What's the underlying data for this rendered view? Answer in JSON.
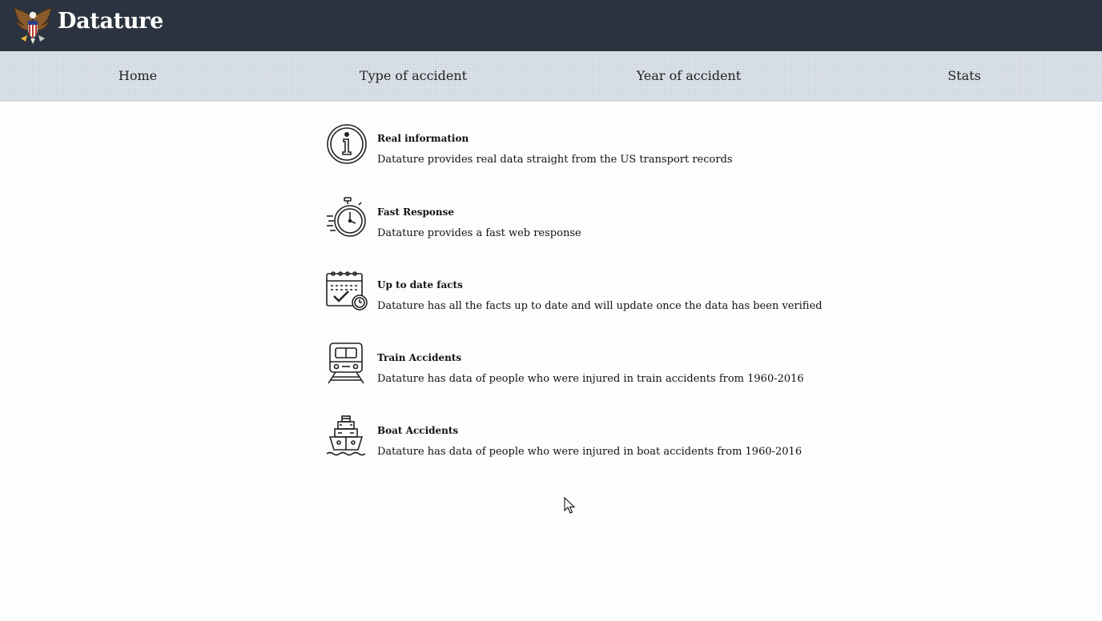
{
  "header": {
    "brand": "Datature",
    "logo_icon": "eagle-emblem-icon"
  },
  "nav": {
    "items": [
      {
        "label": "Home"
      },
      {
        "label": "Type of accident"
      },
      {
        "label": "Year of accident"
      },
      {
        "label": "Stats"
      }
    ]
  },
  "features": [
    {
      "icon": "info-icon",
      "title": "Real information",
      "description": "Datature provides real data straight from the US transport records"
    },
    {
      "icon": "stopwatch-icon",
      "title": "Fast Response",
      "description": "Datature provides a fast web response"
    },
    {
      "icon": "calendar-check-icon",
      "title": "Up to date facts",
      "description": "Datature has all the facts up to date and will update once the data has been verified"
    },
    {
      "icon": "train-icon",
      "title": "Train Accidents",
      "description": "Datature has data of people who were injured in train accidents from 1960-2016"
    },
    {
      "icon": "ship-icon",
      "title": "Boat Accidents",
      "description": "Datature has data of people who were injured in boat accidents from 1960-2016"
    }
  ],
  "colors": {
    "topbar": "#2c3340",
    "navbar": "#dde3ea",
    "background": "#fdfdfd"
  }
}
